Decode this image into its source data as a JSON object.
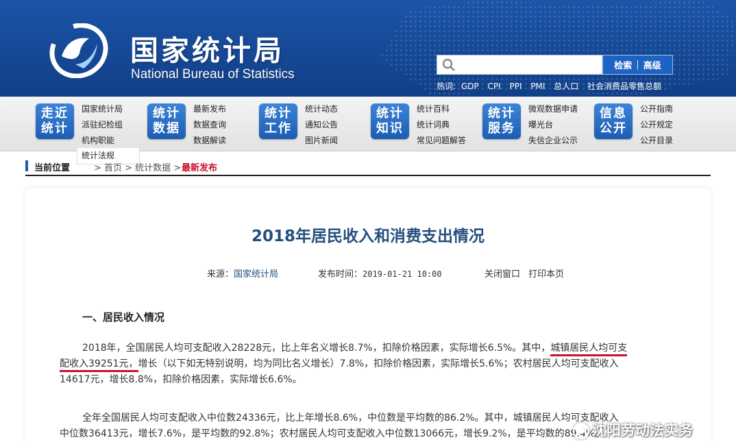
{
  "header": {
    "site_title": "国家统计局",
    "site_subtitle": "National Bureau of Statistics",
    "search": {
      "placeholder": "",
      "btn_search": "检索",
      "btn_sep": "|",
      "btn_advanced": "高级"
    },
    "hot": {
      "label": "热词:",
      "items": [
        "GDP",
        "CPI",
        "PPI",
        "PMI",
        "总人口",
        "社会消费品零售总额"
      ]
    }
  },
  "nav": {
    "groups": [
      {
        "badge": [
          "走近",
          "统计"
        ],
        "links": [
          "国家统计局",
          "派驻纪检组",
          "机构职能"
        ]
      },
      {
        "badge": [
          "统计",
          "数据"
        ],
        "links": [
          "最新发布",
          "数据查询",
          "数据解读"
        ]
      },
      {
        "badge": [
          "统计",
          "工作"
        ],
        "links": [
          "统计动态",
          "通知公告",
          "图片新闻"
        ]
      },
      {
        "badge": [
          "统计",
          "知识"
        ],
        "links": [
          "统计百科",
          "统计词典",
          "常见问题解答"
        ]
      },
      {
        "badge": [
          "统计",
          "服务"
        ],
        "links": [
          "微观数据申请",
          "曝光台",
          "失信企业公示"
        ]
      },
      {
        "badge": [
          "信息",
          "公开"
        ],
        "links": [
          "公开指南",
          "公开规定",
          "公开目录"
        ]
      }
    ],
    "dropdown_extra": "统计法规"
  },
  "breadcrumb": {
    "current_label": "当前位置",
    "middle": "> 首页 > 统计数据 >",
    "last": "最新发布"
  },
  "article": {
    "title": "2018年居民收入和消费支出情况",
    "source_label": "来源：",
    "source_value": "国家统计局",
    "time_label": "发布时间：",
    "time_value": "2019-01-21 10:00",
    "close_window": "关闭窗口",
    "print_page": "打印本页",
    "section1": "一、居民收入情况",
    "p1": {
      "a": "2018年，全国居民人均可支配收入28228元，比上年名义增长8.7%，扣除价格因素，实际增长6.5%。其中，",
      "u1": "城镇居民人均可支",
      "u2": "配收入39251元，",
      "b": "增长（以下如无特别说明，均为同比名义增长）7.8%，扣除价格因素，实际增长5.6%；农村居民人均可支配收入",
      "c": "14617元，增长8.8%，扣除价格因素，实际增长6.6%。"
    },
    "p2": {
      "a": "全年全国居民人均可支配收入中位数24336元，比上年增长8.6%，中位数是平均数的86.2%。其中，城镇居民人均可支配收入",
      "b": "中位数36413元，增长7.6%，是平均数的92.8%；农村居民人均可支配收入中位数13066元，增长9.2%，是平均数的89.4%。"
    }
  },
  "watermark": "沈阳劳动法实务",
  "colors": {
    "header_blue": "#174a98",
    "title_blue": "#234f7e",
    "accent_red": "#c8102e",
    "nav_badge_blue": "#1d5db3"
  }
}
